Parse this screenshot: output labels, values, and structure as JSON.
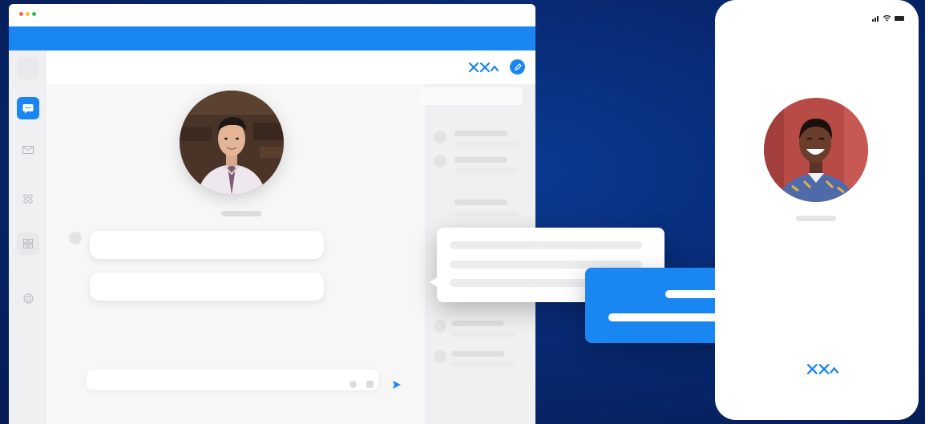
{
  "window": {
    "traffic_lights": [
      "#ff5f57",
      "#febc2e",
      "#28c840"
    ]
  },
  "colors": {
    "accent": "#1a86f2",
    "background_dark": "#061b52",
    "skeleton": "#ececef"
  },
  "sidebar": {
    "items": [
      {
        "icon": "blank-icon",
        "active": false
      },
      {
        "icon": "chat-icon",
        "active": true
      },
      {
        "icon": "mail-icon",
        "active": false
      },
      {
        "icon": "apps-icon",
        "active": false
      },
      {
        "icon": "grid-icon",
        "active": false
      },
      {
        "icon": "settings-icon",
        "active": false
      }
    ]
  },
  "topnav": {
    "logo_icon": "brand-logo-icon",
    "action_icon": "edit-icon"
  },
  "composer": {
    "send_icon": "send-icon"
  },
  "phone": {
    "status_icons": [
      "signal-icon",
      "wifi-icon",
      "battery-icon"
    ],
    "logo_icon": "brand-logo-icon"
  }
}
